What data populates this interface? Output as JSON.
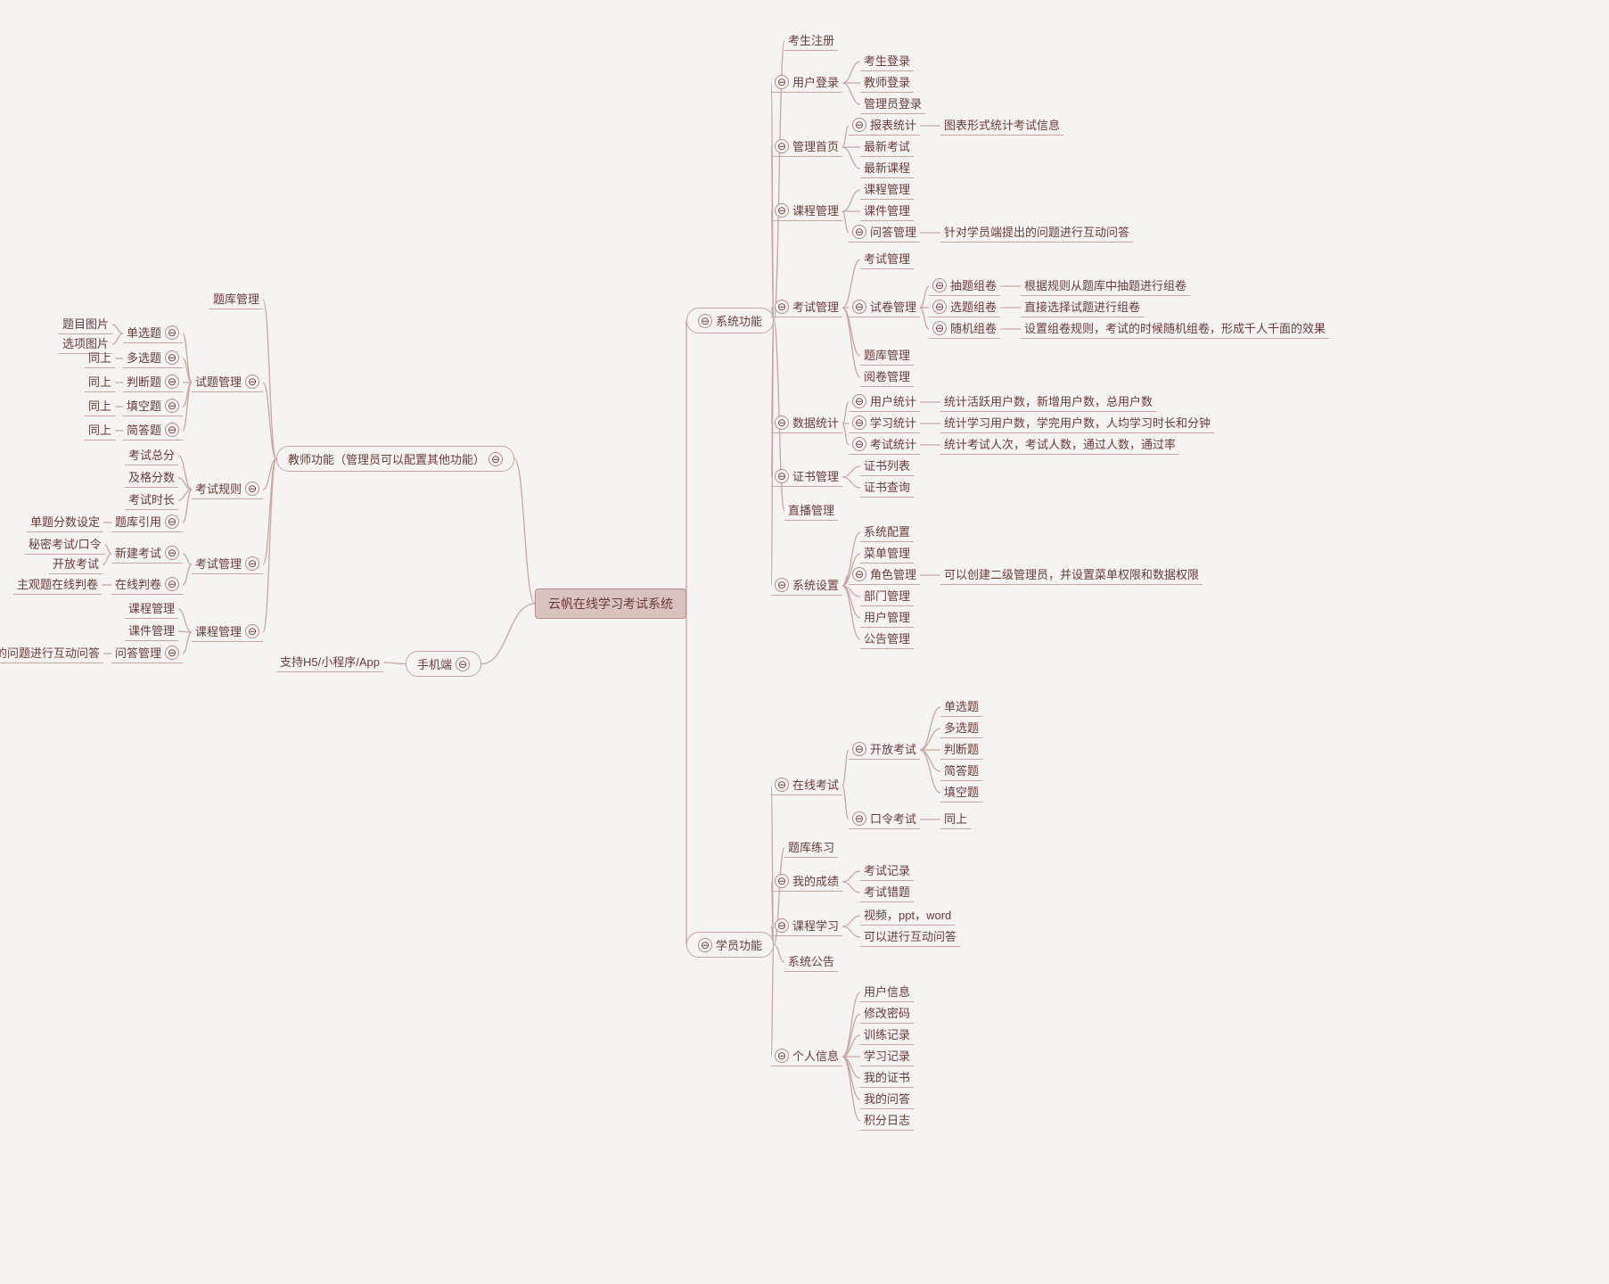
{
  "root": "云帆在线学习考试系统",
  "collapse_glyph": "⊖",
  "left": {
    "teacher": {
      "label": "教师功能（管理员可以配置其他功能）",
      "bank_mgmt": "题库管理",
      "question_mgmt": {
        "label": "试题管理",
        "single": "单选题",
        "single_desc_img": "题目图片",
        "single_opt_img": "选项图片",
        "multi": "多选题",
        "multi_desc": "同上",
        "judge": "判断题",
        "judge_desc": "同上",
        "blank": "填空题",
        "blank_desc": "同上",
        "short": "简答题",
        "short_desc": "同上"
      },
      "rules": {
        "label": "考试规则",
        "total": "考试总分",
        "pass": "及格分数",
        "duration": "考试时长",
        "ref": "题库引用",
        "ref_desc": "单题分数设定"
      },
      "exam_mgmt": {
        "label": "考试管理",
        "new": "新建考试",
        "new_secret": "秘密考试/口令",
        "new_open": "开放考试",
        "judge_online": "在线判卷",
        "judge_desc": "主观题在线判卷"
      },
      "course_mgmt": {
        "label": "课程管理",
        "course": "课程管理",
        "ware": "课件管理",
        "qa": "问答管理",
        "qa_desc": "针对学员端提出的问题进行互动问答"
      }
    },
    "mobile": {
      "label": "手机端",
      "desc": "支持H5/小程序/App"
    }
  },
  "right": {
    "system": {
      "label": "系统功能",
      "register": "考生注册",
      "login": {
        "label": "用户登录",
        "stu": "考生登录",
        "tch": "教师登录",
        "admin": "管理员登录"
      },
      "home": {
        "label": "管理首页",
        "report": "报表统计",
        "report_desc": "图表形式统计考试信息",
        "latest_exam": "最新考试",
        "latest_course": "最新课程"
      },
      "course": {
        "label": "课程管理",
        "course": "课程管理",
        "ware": "课件管理",
        "qa": "问答管理",
        "qa_desc": "针对学员端提出的问题进行互动问答"
      },
      "exam": {
        "label": "考试管理",
        "exam_mgmt": "考试管理",
        "paper_mgmt": "试卷管理",
        "paper_draw": "抽题组卷",
        "paper_draw_desc": "根据规则从题库中抽题进行组卷",
        "paper_pick": "选题组卷",
        "paper_pick_desc": "直接选择试题进行组卷",
        "paper_rand": "随机组卷",
        "paper_rand_desc": "设置组卷规则，考试的时候随机组卷，形成千人千面的效果",
        "bank": "题库管理",
        "review": "阅卷管理"
      },
      "stats": {
        "label": "数据统计",
        "user": "用户统计",
        "user_desc": "统计活跃用户数，新增用户数，总用户数",
        "study": "学习统计",
        "study_desc": "统计学习用户数，学完用户数，人均学习时长和分钟",
        "exam": "考试统计",
        "exam_desc": "统计考试人次，考试人数，通过人数，通过率"
      },
      "cert": {
        "label": "证书管理",
        "list": "证书列表",
        "query": "证书查询"
      },
      "live": "直播管理",
      "settings": {
        "label": "系统设置",
        "cfg": "系统配置",
        "menu": "菜单管理",
        "role": "角色管理",
        "role_desc": "可以创建二级管理员，并设置菜单权限和数据权限",
        "dept": "部门管理",
        "user": "用户管理",
        "notice": "公告管理"
      }
    },
    "student": {
      "label": "学员功能",
      "online_exam": {
        "label": "在线考试",
        "open": "开放考试",
        "open_single": "单选题",
        "open_multi": "多选题",
        "open_judge": "判断题",
        "open_short": "简答题",
        "open_blank": "填空题",
        "pwd": "口令考试",
        "pwd_desc": "同上"
      },
      "practice": "题库练习",
      "scores": {
        "label": "我的成绩",
        "records": "考试记录",
        "wrong": "考试错题"
      },
      "course": {
        "label": "课程学习",
        "media": "视频，ppt，word",
        "qa": "可以进行互动问答"
      },
      "notice": "系统公告",
      "profile": {
        "label": "个人信息",
        "info": "用户信息",
        "pwd": "修改密码",
        "train": "训练记录",
        "study": "学习记录",
        "cert": "我的证书",
        "qa": "我的问答",
        "points": "积分日志"
      }
    }
  }
}
